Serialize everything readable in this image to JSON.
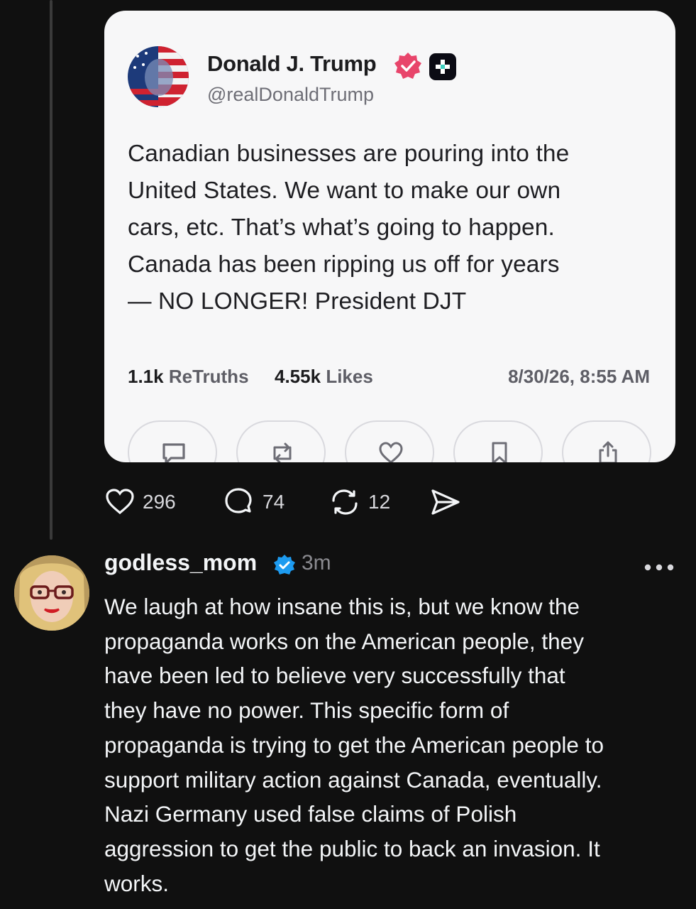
{
  "embedded_post": {
    "display_name": "Donald J. Trump",
    "handle": "@realDonaldTrump",
    "text": "Canadian businesses are pouring into the\nUnited States. We want to make our own\ncars, etc. That’s what’s going to happen.\nCanada has been ripping us off for years\n— NO LONGER! President DJT",
    "retruths_count": "1.1k",
    "retruths_label": "ReTruths",
    "likes_count": "4.55k",
    "likes_label": "Likes",
    "timestamp": "8/30/26, 8:55 AM",
    "actions": [
      "comment-icon",
      "retruth-icon",
      "heart-icon",
      "bookmark-icon",
      "share-icon"
    ],
    "badge_color": "#e8456b",
    "plus_badge_color": "#0b0b14"
  },
  "engagement": {
    "likes": "296",
    "replies": "74",
    "reposts": "12"
  },
  "reply": {
    "username": "godless_mom",
    "time": "3m",
    "verified_color": "#1d9bf0",
    "text": "We laugh at how insane this is, but we know the\npropaganda works on the American people, they\nhave been led to believe very successfully that\nthey have no power. This specific form of\npropaganda is trying to get the American people to\nsupport military action against Canada, eventually.\nNazi Germany used false claims of Polish\naggression to get the public to back an invasion. It\nworks."
  }
}
